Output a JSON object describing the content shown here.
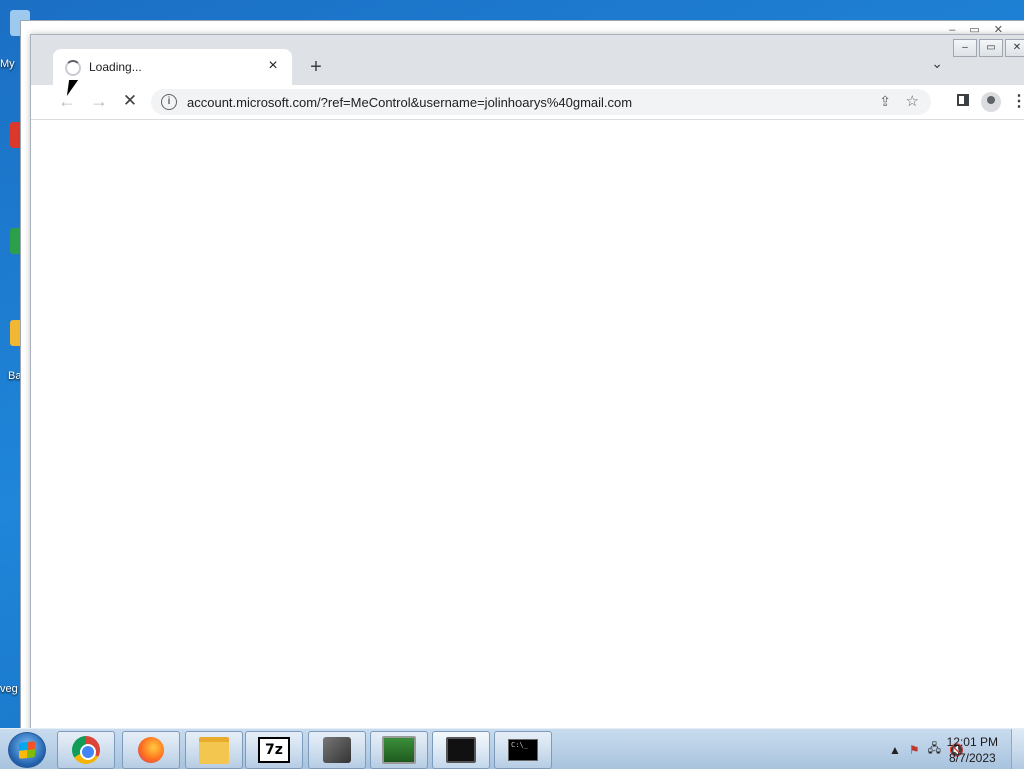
{
  "desktop": {
    "icons": [
      {
        "label": "My"
      },
      {
        "label": "Ba"
      },
      {
        "label": "veg"
      }
    ]
  },
  "browser": {
    "tab": {
      "title": "Loading...",
      "close": "×"
    },
    "new_tab": "+",
    "tab_search": "⌄",
    "window_controls": {
      "minimize": "–",
      "maximize": "▭",
      "close": "✕"
    },
    "nav": {
      "back": "←",
      "forward": "→",
      "stop": "✕"
    },
    "omnibox": {
      "info": "i",
      "url": "account.microsoft.com/?ref=MeControl&username=jolinhoarys%40gmail.com",
      "share": "⇪",
      "star": "☆"
    },
    "menu": "⋮"
  },
  "taskbar": {
    "apps": [
      {
        "name": "chrome",
        "active": false
      },
      {
        "name": "firefox",
        "active": false
      },
      {
        "name": "file-explorer",
        "active": false
      },
      {
        "name": "7zip",
        "label": "7z",
        "active": false
      },
      {
        "name": "app-box",
        "active": false
      },
      {
        "name": "network-monitor",
        "active": false
      },
      {
        "name": "video-player",
        "active": true
      },
      {
        "name": "command-prompt",
        "label": "C:\\_",
        "active": false
      }
    ],
    "tray": {
      "chevron": "▲",
      "flag": "⚑",
      "network": "🖧",
      "volume": "🔇"
    },
    "clock": {
      "time": "12:01 PM",
      "date": "8/7/2023"
    }
  }
}
